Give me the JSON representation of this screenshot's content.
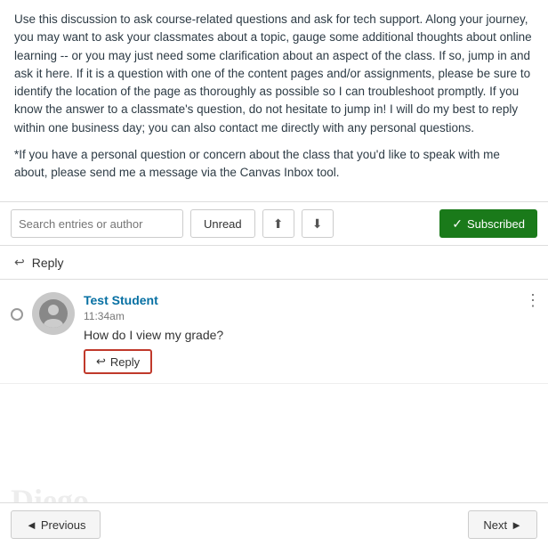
{
  "description": {
    "paragraph1": "Use this discussion to ask course-related questions and ask for tech support. Along your journey, you may want to ask your classmates about a topic, gauge some additional thoughts about online learning -- or you may just need some clarification about an aspect of the class. If so, jump in and ask it here. If it is a question with one of the content pages and/or assignments, please be sure to identify the location of the page as thoroughly as possible so I can troubleshoot promptly. If you know the answer to a classmate's question, do not hesitate to jump in! I will do my best to reply within one business day; you can also contact me directly with any personal questions.",
    "paragraph2": "*If you have a personal question or concern about the class that you'd like to speak with me about, please  send me a message via the Canvas Inbox tool."
  },
  "toolbar": {
    "search_placeholder": "Search entries or author",
    "unread_label": "Unread",
    "subscribed_label": "Subscribed",
    "subscribed_check": "✓",
    "icon_collapse": "⬆",
    "icon_expand": "⬇"
  },
  "reply_bar": {
    "icon": "↩",
    "label": "Reply"
  },
  "posts": [
    {
      "author": "Test Student",
      "time": "11:34am",
      "text": "How do I view my grade?",
      "reply_icon": "↩",
      "reply_label": "Reply",
      "menu_icon": "⋮"
    }
  ],
  "watermark": {
    "text": "Diego"
  },
  "footer": {
    "previous_icon": "◄",
    "previous_label": "Previous",
    "next_label": "Next",
    "next_icon": "►"
  }
}
